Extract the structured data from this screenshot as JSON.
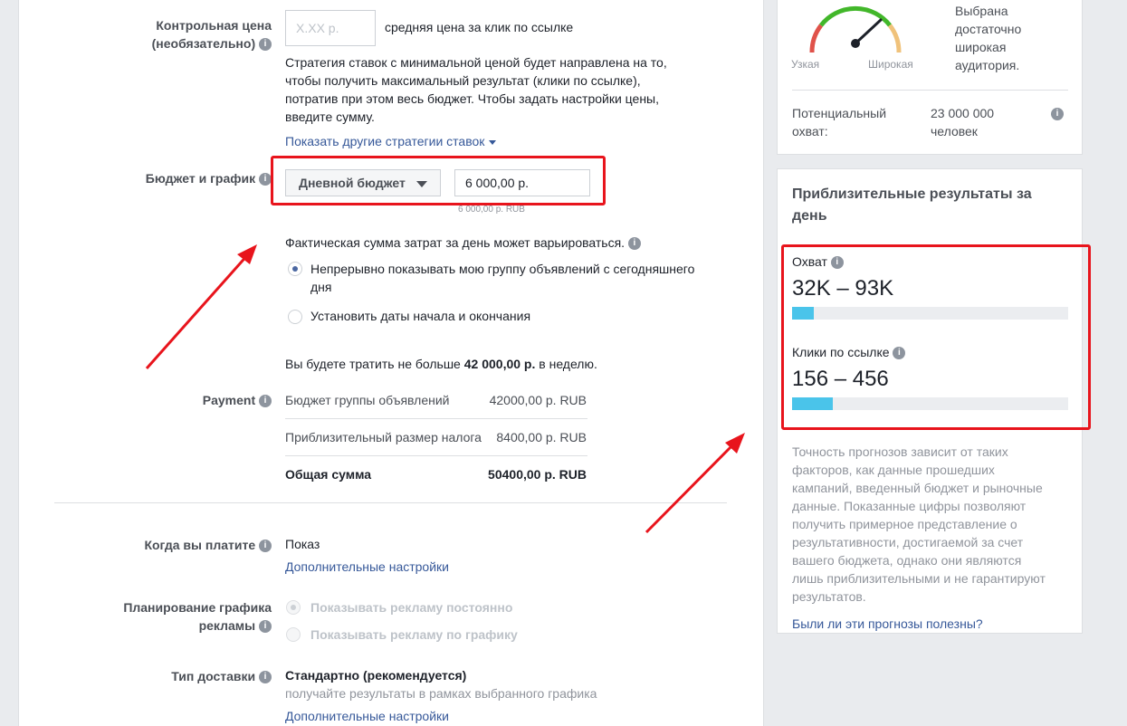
{
  "bid": {
    "label_line1": "Контрольная цена",
    "label_line2": "(необязательно)",
    "placeholder": "X.XX р.",
    "suffix": "средняя цена за клик по ссылке",
    "description": [
      "Стратегия ставок с минимальной ценой будет направлена на то,",
      "чтобы получить максимальный результат (клики по ссылке),",
      "потратив при этом весь бюджет. Чтобы задать настройки цены,",
      "введите сумму."
    ],
    "show_strategies": "Показать другие стратегии ставок"
  },
  "budget": {
    "label": "Бюджет и график",
    "dropdown": "Дневной бюджет",
    "value": "6 000,00 р.",
    "hint": "6 000,00 р. RUB",
    "note": "Фактическая сумма затрат за день может варьироваться.",
    "option1_line1": "Непрерывно показывать мою группу объявлений с сегодняшнего",
    "option1_line2": "дня",
    "option2": "Установить даты начала и окончания",
    "weekly_prefix": "Вы будете тратить не больше ",
    "weekly_amount": "42 000,00 р.",
    "weekly_suffix": " в неделю."
  },
  "payment": {
    "label": "Payment",
    "rows": [
      {
        "name": "Бюджет группы объявлений",
        "value": "42000,00 р. RUB"
      },
      {
        "name": "Приблизительный размер налога",
        "value": "8400,00 р. RUB"
      },
      {
        "name": "Общая сумма",
        "value": "50400,00 р. RUB"
      }
    ]
  },
  "when_pay": {
    "label": "Когда вы платите",
    "value": "Показ",
    "more": "Дополнительные настройки"
  },
  "schedule": {
    "label_line1": "Планирование графика",
    "label_line2": "рекламы",
    "option1": "Показывать рекламу постоянно",
    "option2": "Показывать рекламу по графику"
  },
  "delivery": {
    "label": "Тип доставки",
    "value": "Стандартно (рекомендуется)",
    "sub": "получайте результаты в рамках выбранного графика",
    "more": "Дополнительные настройки"
  },
  "audience": {
    "gauge_left": "Узкая",
    "gauge_right": "Широкая",
    "gauge_text": [
      "Выбрана",
      "достаточно",
      "широкая",
      "аудитория."
    ],
    "reach_label_line1": "Потенциальный",
    "reach_label_line2": "охват:",
    "reach_value_line1": "23 000 000",
    "reach_value_line2": "человек"
  },
  "estimates": {
    "title_line1": "Приблизительные результаты за",
    "title_line2": "день",
    "reach_label": "Охват",
    "reach_value": "32K – 93K",
    "reach_fill": 0.08,
    "clicks_label": "Клики по ссылке",
    "clicks_value": "156 – 456",
    "clicks_fill": 0.147,
    "disclaimer": [
      "Точность прогнозов зависит от таких",
      "факторов, как данные прошедших",
      "кампаний, введенный бюджет и рыночные",
      "данные. Показанные цифры позволяют",
      "получить примерное представление о",
      "результативности, достигаемой за счет",
      "вашего бюджета, однако они являются",
      "лишь приблизительными и не гарантируют",
      "результатов."
    ],
    "feedback": "Были ли эти прогнозы полезны?"
  },
  "colors": {
    "highlight": "#e8141c",
    "bar": "#4ac4ea",
    "link": "#365899"
  },
  "icons": {
    "info": "info-icon",
    "dropdown": "caret-down-icon",
    "gauge": "audience-gauge-icon",
    "arrow": "red-arrow-annotation"
  }
}
